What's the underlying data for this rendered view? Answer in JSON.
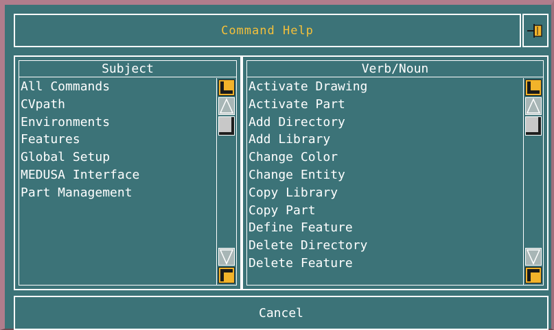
{
  "window": {
    "title": "Command Help",
    "colors": {
      "background": "#3c7378",
      "title": "#f5c03a",
      "text": "#ffffff",
      "accent": "#f2b32a"
    }
  },
  "pin_icon": "pushpin-icon",
  "subject": {
    "header": "Subject",
    "items": [
      "All Commands",
      "CVpath",
      "Environments",
      "Features",
      "Global Setup",
      "MEDUSA Interface",
      "Part Management"
    ]
  },
  "verbnoun": {
    "header": "Verb/Noun",
    "items": [
      "Activate Drawing",
      "Activate Part",
      "Add Directory",
      "Add Library",
      "Change Color",
      "Change Entity",
      "Copy Library",
      "Copy Part",
      "Define Feature",
      "Delete Directory",
      "Delete Feature"
    ]
  },
  "cancel_label": "Cancel"
}
